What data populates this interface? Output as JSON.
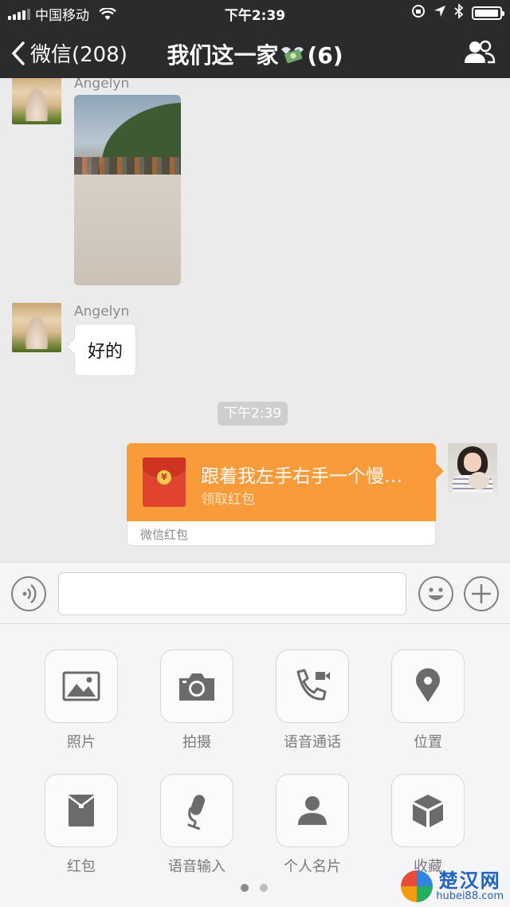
{
  "status_bar": {
    "carrier": "中国移动",
    "time": "下午2:39",
    "battery_level": 0.95
  },
  "nav": {
    "back_label": "微信(208)",
    "title": "我们这一家",
    "member_count": "(6)",
    "title_emoji": "money-with-wings"
  },
  "messages": {
    "photo_sender": "Angelyn",
    "text_sender": "Angelyn",
    "text_message": "好的",
    "timestamp": "下午2:39",
    "red_packet": {
      "title": "跟着我左手右手一个慢…",
      "subtitle": "领取红包",
      "footer": "微信红包"
    }
  },
  "input": {
    "placeholder": ""
  },
  "panel": {
    "items": [
      {
        "label": "照片",
        "icon": "photo-icon"
      },
      {
        "label": "拍摄",
        "icon": "camera-icon"
      },
      {
        "label": "语音通话",
        "icon": "voice-call-icon"
      },
      {
        "label": "位置",
        "icon": "location-icon"
      },
      {
        "label": "红包",
        "icon": "red-packet-icon"
      },
      {
        "label": "语音输入",
        "icon": "microphone-icon"
      },
      {
        "label": "个人名片",
        "icon": "contact-card-icon"
      },
      {
        "label": "收藏",
        "icon": "favorites-icon"
      }
    ],
    "page_count": 2,
    "current_page": 1
  },
  "watermark": {
    "name": "楚汉网",
    "url": "hubei88.com"
  },
  "colors": {
    "nav_bg": "#2b2b2e",
    "chat_bg": "#ebebeb",
    "red_packet": "#f99b3a",
    "panel_bg": "#f5f5f7"
  }
}
